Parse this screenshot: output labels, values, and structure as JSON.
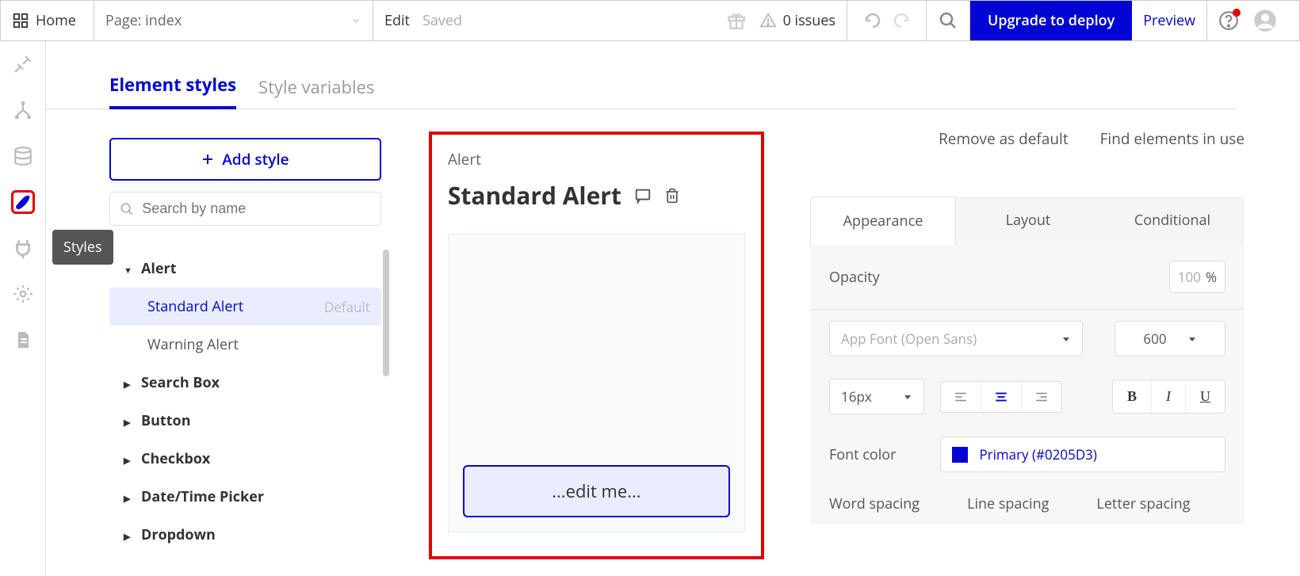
{
  "topbar": {
    "home": "Home",
    "page_label": "Page: index",
    "edit": "Edit",
    "status": "Saved",
    "issues": "0 issues",
    "deploy": "Upgrade to deploy",
    "preview": "Preview"
  },
  "sidebar_tooltip": "Styles",
  "tabs": {
    "element_styles": "Element styles",
    "style_variables": "Style variables"
  },
  "left": {
    "add_style": "Add style",
    "search_placeholder": "Search by name",
    "tree": [
      {
        "label": "Alert",
        "expanded": true,
        "children": [
          {
            "label": "Standard Alert",
            "tag": "Default",
            "selected": true
          },
          {
            "label": "Warning Alert"
          }
        ]
      },
      {
        "label": "Search Box"
      },
      {
        "label": "Button"
      },
      {
        "label": "Checkbox"
      },
      {
        "label": "Date/Time Picker"
      },
      {
        "label": "Dropdown"
      }
    ]
  },
  "canvas": {
    "type_label": "Alert",
    "title": "Standard Alert",
    "placeholder": "...edit me..."
  },
  "right": {
    "remove_default": "Remove as default",
    "find_elements": "Find elements in use",
    "tabs": {
      "appearance": "Appearance",
      "layout": "Layout",
      "conditional": "Conditional"
    },
    "opacity_label": "Opacity",
    "opacity_value": "100",
    "opacity_unit": "%",
    "font_select": "App Font (Open Sans)",
    "weight": "600",
    "size": "16px",
    "font_color_label": "Font color",
    "font_color_value": "Primary (#0205D3)",
    "word_spacing": "Word spacing",
    "line_spacing": "Line spacing",
    "letter_spacing": "Letter spacing"
  }
}
